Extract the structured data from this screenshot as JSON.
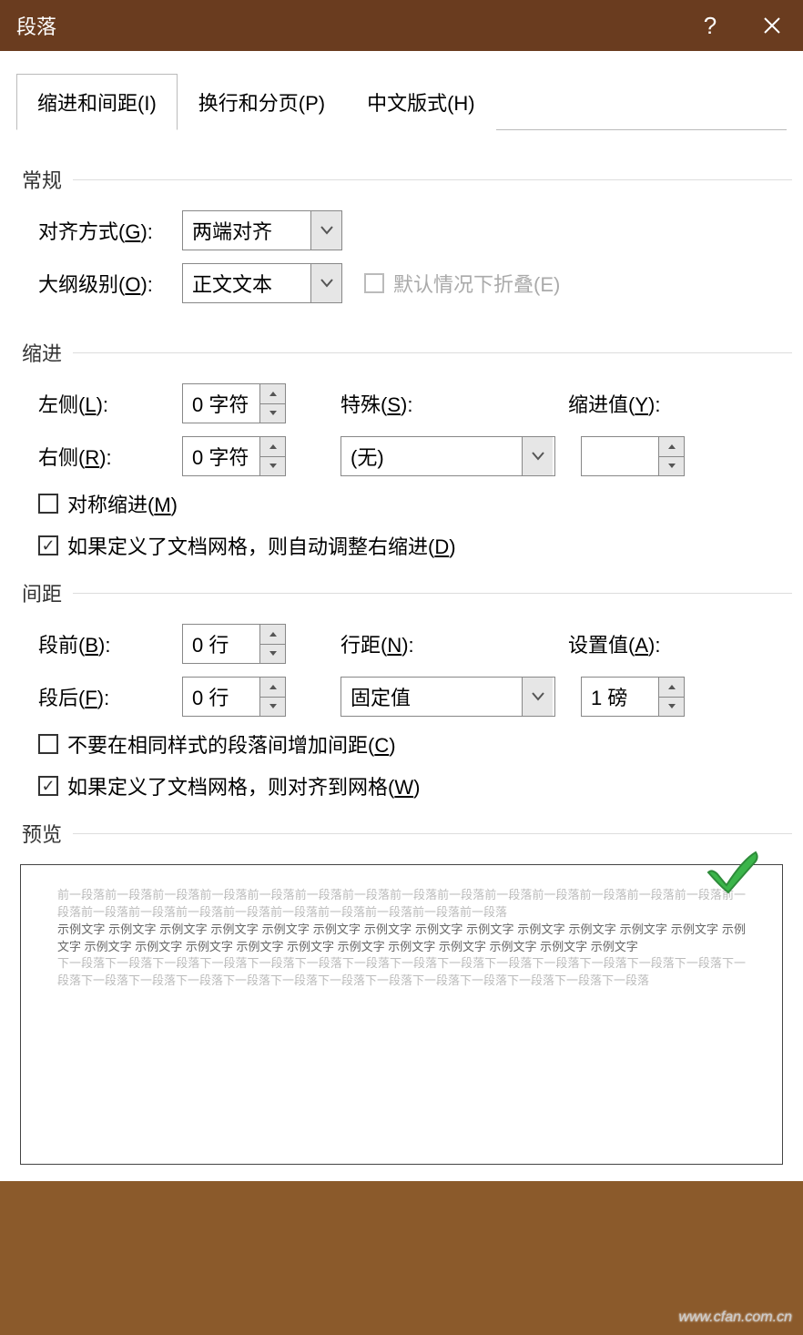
{
  "title": "段落",
  "tabs": [
    "缩进和间距(I)",
    "换行和分页(P)",
    "中文版式(H)"
  ],
  "general": {
    "title": "常规",
    "align_label": "对齐方式(G):",
    "align_value": "两端对齐",
    "outline_label": "大纲级别(O):",
    "outline_value": "正文文本",
    "collapse_label": "默认情况下折叠(E)"
  },
  "indent": {
    "title": "缩进",
    "left_label": "左侧(L):",
    "left_value": "0 字符",
    "right_label": "右侧(R):",
    "right_value": "0 字符",
    "special_label": "特殊(S):",
    "special_value": "(无)",
    "by_label": "缩进值(Y):",
    "by_value": "",
    "mirror_label": "对称缩进(M)",
    "grid_label": "如果定义了文档网格，则自动调整右缩进(D)"
  },
  "spacing": {
    "title": "间距",
    "before_label": "段前(B):",
    "before_value": "0 行",
    "after_label": "段后(F):",
    "after_value": "0 行",
    "linespace_label": "行距(N):",
    "linespace_value": "固定值",
    "at_label": "设置值(A):",
    "at_value": "1 磅",
    "nospace_label": "不要在相同样式的段落间增加间距(C)",
    "grid_label": "如果定义了文档网格，则对齐到网格(W)"
  },
  "preview": {
    "title": "预览",
    "before_para": "前一段落前一段落前一段落前一段落前一段落前一段落前一段落前一段落前一段落前一段落前一段落前一段落前一段落前一段落前一段落前一段落前一段落前一段落前一段落前一段落前一段落前一段落前一段落前一段落",
    "sample": "示例文字 示例文字 示例文字 示例文字 示例文字 示例文字 示例文字 示例文字 示例文字 示例文字 示例文字 示例文字 示例文字 示例文字 示例文字 示例文字 示例文字 示例文字 示例文字 示例文字 示例文字 示例文字 示例文字 示例文字 示例文字",
    "after_para": "下一段落下一段落下一段落下一段落下一段落下一段落下一段落下一段落下一段落下一段落下一段落下一段落下一段落下一段落下一段落下一段落下一段落下一段落下一段落下一段落下一段落下一段落下一段落下一段落下一段落下一段落下一段落"
  },
  "watermark": "www.cfan.com.cn"
}
